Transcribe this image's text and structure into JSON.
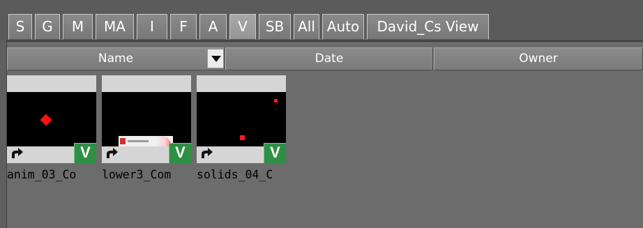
{
  "tabs": [
    {
      "label": "S",
      "active": false
    },
    {
      "label": "G",
      "active": false
    },
    {
      "label": "M",
      "active": false
    },
    {
      "label": "MA",
      "active": false
    },
    {
      "label": "I",
      "active": false
    },
    {
      "label": "F",
      "active": false
    },
    {
      "label": "A",
      "active": false
    },
    {
      "label": "V",
      "active": true
    },
    {
      "label": "SB",
      "active": false
    },
    {
      "label": "All",
      "active": false
    },
    {
      "label": "Auto",
      "active": false
    },
    {
      "label": "David_Cs View",
      "active": false
    }
  ],
  "columns": {
    "name": "Name",
    "date": "Date",
    "owner": "Owner"
  },
  "items": [
    {
      "label": "anim_03_Co",
      "badge": "V",
      "thumbnail": "red-diamond-on-black"
    },
    {
      "label": "lower3_Com",
      "badge": "V",
      "thumbnail": "lower-third-graphic"
    },
    {
      "label": "solids_04_C",
      "badge": "V",
      "thumbnail": "red-dots-on-black"
    }
  ],
  "colors": {
    "background": "#6c6c6c",
    "tab": "#808080",
    "badge": "#2f8f45",
    "accent_red": "#ff1010"
  }
}
